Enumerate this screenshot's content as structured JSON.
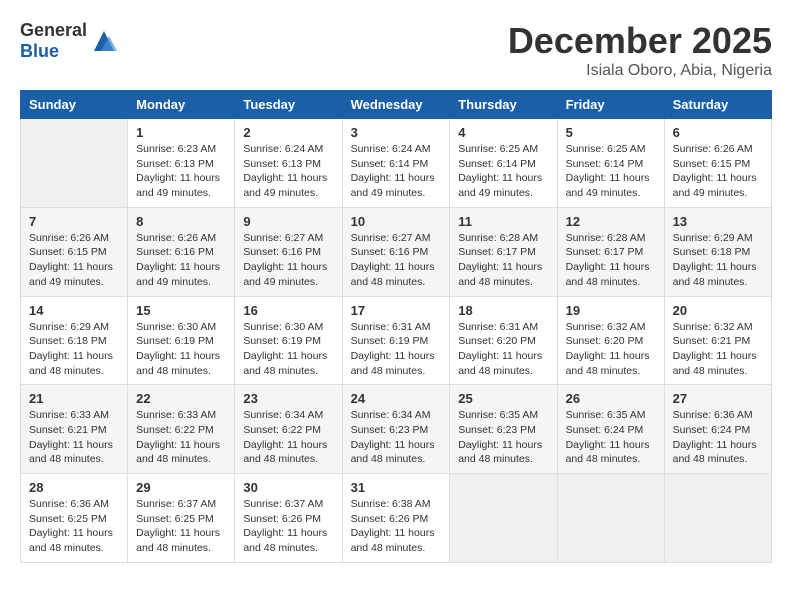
{
  "header": {
    "logo_general": "General",
    "logo_blue": "Blue",
    "month_title": "December 2025",
    "location": "Isiala Oboro, Abia, Nigeria"
  },
  "weekdays": [
    "Sunday",
    "Monday",
    "Tuesday",
    "Wednesday",
    "Thursday",
    "Friday",
    "Saturday"
  ],
  "weeks": [
    [
      {
        "day": "",
        "sunrise": "",
        "sunset": "",
        "daylight": ""
      },
      {
        "day": "1",
        "sunrise": "Sunrise: 6:23 AM",
        "sunset": "Sunset: 6:13 PM",
        "daylight": "Daylight: 11 hours and 49 minutes."
      },
      {
        "day": "2",
        "sunrise": "Sunrise: 6:24 AM",
        "sunset": "Sunset: 6:13 PM",
        "daylight": "Daylight: 11 hours and 49 minutes."
      },
      {
        "day": "3",
        "sunrise": "Sunrise: 6:24 AM",
        "sunset": "Sunset: 6:14 PM",
        "daylight": "Daylight: 11 hours and 49 minutes."
      },
      {
        "day": "4",
        "sunrise": "Sunrise: 6:25 AM",
        "sunset": "Sunset: 6:14 PM",
        "daylight": "Daylight: 11 hours and 49 minutes."
      },
      {
        "day": "5",
        "sunrise": "Sunrise: 6:25 AM",
        "sunset": "Sunset: 6:14 PM",
        "daylight": "Daylight: 11 hours and 49 minutes."
      },
      {
        "day": "6",
        "sunrise": "Sunrise: 6:26 AM",
        "sunset": "Sunset: 6:15 PM",
        "daylight": "Daylight: 11 hours and 49 minutes."
      }
    ],
    [
      {
        "day": "7",
        "sunrise": "Sunrise: 6:26 AM",
        "sunset": "Sunset: 6:15 PM",
        "daylight": "Daylight: 11 hours and 49 minutes."
      },
      {
        "day": "8",
        "sunrise": "Sunrise: 6:26 AM",
        "sunset": "Sunset: 6:16 PM",
        "daylight": "Daylight: 11 hours and 49 minutes."
      },
      {
        "day": "9",
        "sunrise": "Sunrise: 6:27 AM",
        "sunset": "Sunset: 6:16 PM",
        "daylight": "Daylight: 11 hours and 49 minutes."
      },
      {
        "day": "10",
        "sunrise": "Sunrise: 6:27 AM",
        "sunset": "Sunset: 6:16 PM",
        "daylight": "Daylight: 11 hours and 48 minutes."
      },
      {
        "day": "11",
        "sunrise": "Sunrise: 6:28 AM",
        "sunset": "Sunset: 6:17 PM",
        "daylight": "Daylight: 11 hours and 48 minutes."
      },
      {
        "day": "12",
        "sunrise": "Sunrise: 6:28 AM",
        "sunset": "Sunset: 6:17 PM",
        "daylight": "Daylight: 11 hours and 48 minutes."
      },
      {
        "day": "13",
        "sunrise": "Sunrise: 6:29 AM",
        "sunset": "Sunset: 6:18 PM",
        "daylight": "Daylight: 11 hours and 48 minutes."
      }
    ],
    [
      {
        "day": "14",
        "sunrise": "Sunrise: 6:29 AM",
        "sunset": "Sunset: 6:18 PM",
        "daylight": "Daylight: 11 hours and 48 minutes."
      },
      {
        "day": "15",
        "sunrise": "Sunrise: 6:30 AM",
        "sunset": "Sunset: 6:19 PM",
        "daylight": "Daylight: 11 hours and 48 minutes."
      },
      {
        "day": "16",
        "sunrise": "Sunrise: 6:30 AM",
        "sunset": "Sunset: 6:19 PM",
        "daylight": "Daylight: 11 hours and 48 minutes."
      },
      {
        "day": "17",
        "sunrise": "Sunrise: 6:31 AM",
        "sunset": "Sunset: 6:19 PM",
        "daylight": "Daylight: 11 hours and 48 minutes."
      },
      {
        "day": "18",
        "sunrise": "Sunrise: 6:31 AM",
        "sunset": "Sunset: 6:20 PM",
        "daylight": "Daylight: 11 hours and 48 minutes."
      },
      {
        "day": "19",
        "sunrise": "Sunrise: 6:32 AM",
        "sunset": "Sunset: 6:20 PM",
        "daylight": "Daylight: 11 hours and 48 minutes."
      },
      {
        "day": "20",
        "sunrise": "Sunrise: 6:32 AM",
        "sunset": "Sunset: 6:21 PM",
        "daylight": "Daylight: 11 hours and 48 minutes."
      }
    ],
    [
      {
        "day": "21",
        "sunrise": "Sunrise: 6:33 AM",
        "sunset": "Sunset: 6:21 PM",
        "daylight": "Daylight: 11 hours and 48 minutes."
      },
      {
        "day": "22",
        "sunrise": "Sunrise: 6:33 AM",
        "sunset": "Sunset: 6:22 PM",
        "daylight": "Daylight: 11 hours and 48 minutes."
      },
      {
        "day": "23",
        "sunrise": "Sunrise: 6:34 AM",
        "sunset": "Sunset: 6:22 PM",
        "daylight": "Daylight: 11 hours and 48 minutes."
      },
      {
        "day": "24",
        "sunrise": "Sunrise: 6:34 AM",
        "sunset": "Sunset: 6:23 PM",
        "daylight": "Daylight: 11 hours and 48 minutes."
      },
      {
        "day": "25",
        "sunrise": "Sunrise: 6:35 AM",
        "sunset": "Sunset: 6:23 PM",
        "daylight": "Daylight: 11 hours and 48 minutes."
      },
      {
        "day": "26",
        "sunrise": "Sunrise: 6:35 AM",
        "sunset": "Sunset: 6:24 PM",
        "daylight": "Daylight: 11 hours and 48 minutes."
      },
      {
        "day": "27",
        "sunrise": "Sunrise: 6:36 AM",
        "sunset": "Sunset: 6:24 PM",
        "daylight": "Daylight: 11 hours and 48 minutes."
      }
    ],
    [
      {
        "day": "28",
        "sunrise": "Sunrise: 6:36 AM",
        "sunset": "Sunset: 6:25 PM",
        "daylight": "Daylight: 11 hours and 48 minutes."
      },
      {
        "day": "29",
        "sunrise": "Sunrise: 6:37 AM",
        "sunset": "Sunset: 6:25 PM",
        "daylight": "Daylight: 11 hours and 48 minutes."
      },
      {
        "day": "30",
        "sunrise": "Sunrise: 6:37 AM",
        "sunset": "Sunset: 6:26 PM",
        "daylight": "Daylight: 11 hours and 48 minutes."
      },
      {
        "day": "31",
        "sunrise": "Sunrise: 6:38 AM",
        "sunset": "Sunset: 6:26 PM",
        "daylight": "Daylight: 11 hours and 48 minutes."
      },
      {
        "day": "",
        "sunrise": "",
        "sunset": "",
        "daylight": ""
      },
      {
        "day": "",
        "sunrise": "",
        "sunset": "",
        "daylight": ""
      },
      {
        "day": "",
        "sunrise": "",
        "sunset": "",
        "daylight": ""
      }
    ]
  ]
}
